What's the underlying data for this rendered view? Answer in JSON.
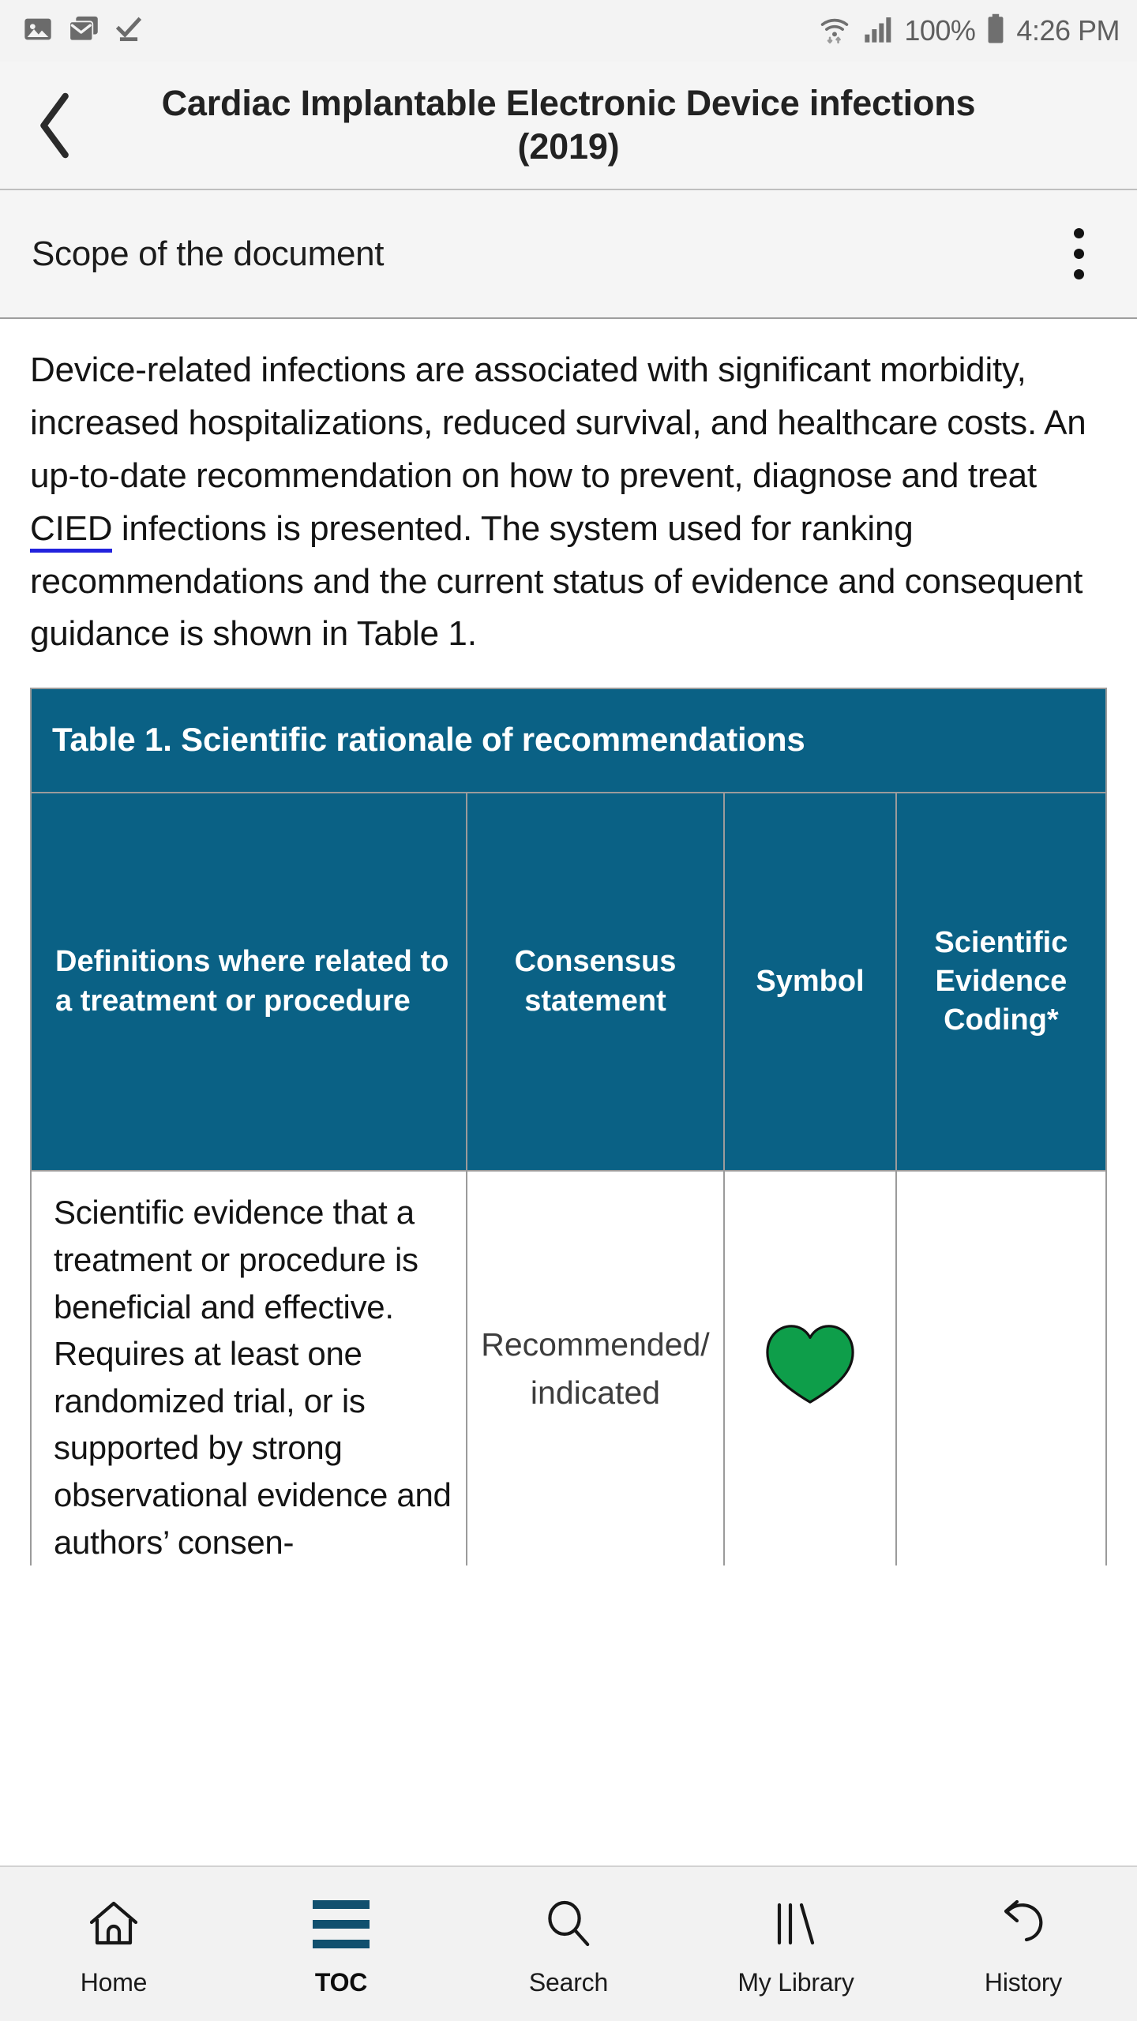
{
  "status_bar": {
    "icons": [
      "image-icon",
      "mail-stack-icon",
      "download-complete-icon",
      "wifi-icon",
      "cellular-signal-icon",
      "battery-icon"
    ],
    "battery_percent": "100%",
    "time": "4:26 PM"
  },
  "header": {
    "back_label": "Back",
    "title": "Cardiac Implantable Electronic Device infections (2019)"
  },
  "section_bar": {
    "title": "Scope of the document",
    "menu_label": "More options"
  },
  "body": {
    "paragraph_pre_link": "Device-related infections are associated with significant morbidity, increased hospitalizations, reduced survival, and healthcare costs. An up-to-date recommendation on how to prevent, diagnose and treat ",
    "paragraph_link": "CIED",
    "paragraph_post_link": " infections is presented. The system used for ranking recommendations and the current status of evidence and consequent guidance is shown in Table 1."
  },
  "table": {
    "caption": "Table 1. Scientific rationale of recommendations",
    "headers": [
      "Definitions where related to a treatment or procedure",
      "Consensus statement",
      "Symbol",
      "Scientific Evidence Coding*"
    ],
    "rows": [
      {
        "definition": "Scientific evidence that a treatment or procedure is beneficial and effective. Requires at least one randomized trial, or is supported by strong observational evidence and authors’ consen-",
        "consensus": "Recommended/ indicated",
        "symbol": "green-heart-icon",
        "symbol_color": "#0e9e4a",
        "coding": ""
      }
    ],
    "accent_color": "#0a6185",
    "border_color": "#9b9b9b"
  },
  "bottom_nav": {
    "items": [
      {
        "label": "Home",
        "icon": "home-icon",
        "active": false
      },
      {
        "label": "TOC",
        "icon": "toc-hamburger-icon",
        "active": true
      },
      {
        "label": "Search",
        "icon": "search-icon",
        "active": false
      },
      {
        "label": "My Library",
        "icon": "library-books-icon",
        "active": false
      },
      {
        "label": "History",
        "icon": "history-undo-icon",
        "active": false
      }
    ],
    "active_color": "#11506e"
  }
}
